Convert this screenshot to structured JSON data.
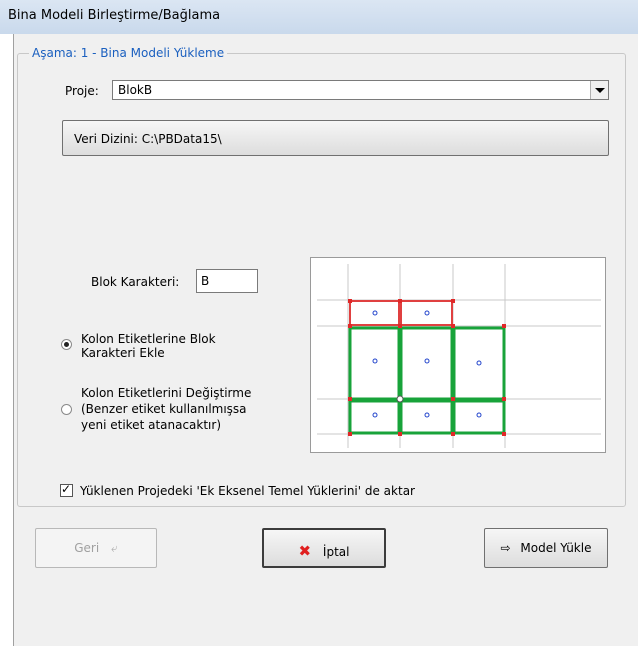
{
  "window": {
    "title": "Bina Modeli Birleştirme/Bağlama"
  },
  "group": {
    "label": "Aşama: 1 - Bina Modeli Yükleme"
  },
  "project": {
    "label": "Proje:",
    "value": "BlokB"
  },
  "data_dir": {
    "label": "Veri Dizini: C:\\PBData15\\"
  },
  "block": {
    "label": "Blok Karakteri:",
    "value": "B"
  },
  "options": {
    "add_line1": "Kolon Etiketlerine Blok",
    "add_line2": "Karakteri Ekle",
    "add_checked": true,
    "keep_line1": "Kolon Etiketlerini Değiştirme",
    "keep_line2": "(Benzer etiket kullanılmışsa",
    "keep_line3": "yeni etiket atanacaktır)",
    "keep_checked": false
  },
  "transfer": {
    "label": "Yüklenen Projedeki 'Ek Eksenel Temel Yüklerini' de aktar",
    "checked": true
  },
  "buttons": {
    "back": "Geri",
    "cancel": "İptal",
    "load_model": "Model Yükle"
  },
  "icons": {
    "back": "undo-arrow-icon",
    "cancel": "red-x-icon",
    "load": "arrow-right-icon"
  },
  "colors": {
    "group_label": "#1a5fbf",
    "cancel_x": "#e02020",
    "beam_green": "#18a33a",
    "joint_red": "#e02828"
  }
}
